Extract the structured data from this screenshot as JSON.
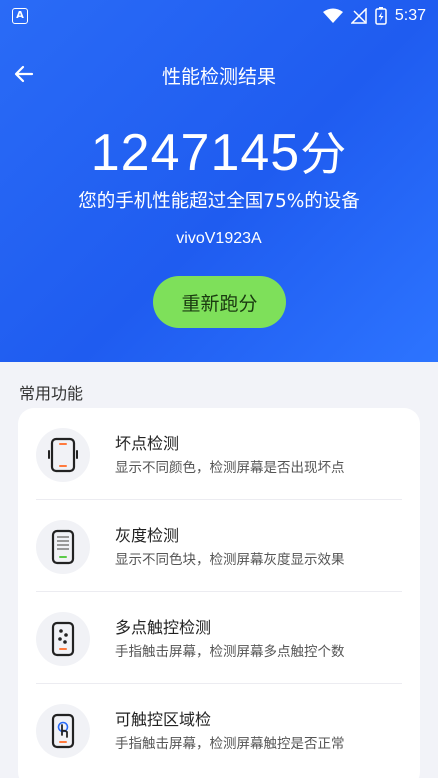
{
  "status_bar": {
    "app_icon": "A",
    "time": "5:37"
  },
  "header": {
    "title": "性能检测结果"
  },
  "result": {
    "score": "1247145",
    "score_unit": "分",
    "summary": "您的手机性能超过全国75%的设备",
    "device": "vivoV1923A"
  },
  "rerun_label": "重新跑分",
  "section_title": "常用功能",
  "features": [
    {
      "title": "坏点检测",
      "desc": "显示不同颜色，检测屏幕是否出现坏点",
      "icon": "dead-pixel-phone-icon"
    },
    {
      "title": "灰度检测",
      "desc": "显示不同色块，检测屏幕灰度显示效果",
      "icon": "grayscale-phone-icon"
    },
    {
      "title": "多点触控检测",
      "desc": "手指触击屏幕，检测屏幕多点触控个数",
      "icon": "multitouch-phone-icon"
    },
    {
      "title": "可触控区域检",
      "desc": "手指触击屏幕，检测屏幕触控是否正常",
      "icon": "touch-area-phone-icon"
    }
  ],
  "colors": {
    "hero_blue": "#1f5cf0",
    "button_green": "#7ee05a",
    "accent_orange": "#ff7a3d"
  }
}
